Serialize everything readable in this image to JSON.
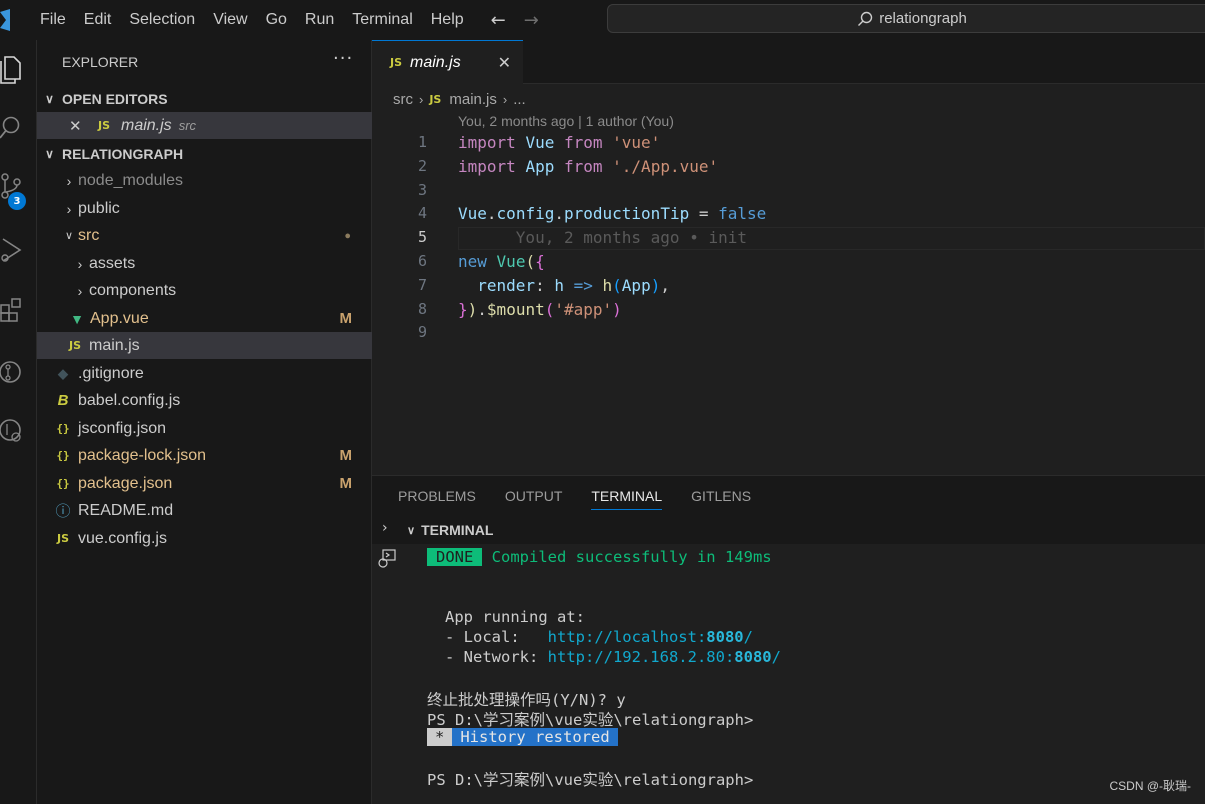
{
  "menu": [
    "File",
    "Edit",
    "Selection",
    "View",
    "Go",
    "Run",
    "Terminal",
    "Help"
  ],
  "command_center": {
    "text": "relationgraph"
  },
  "activity_bar": {
    "items": [
      "explorer-icon",
      "search-icon",
      "source-control-icon",
      "run-debug-icon",
      "extensions-icon",
      "gitlens-icon",
      "remote-explorer-icon"
    ],
    "source_control_badge": "3"
  },
  "sidebar": {
    "title": "EXPLORER",
    "more": "···",
    "open_editors": {
      "header": "OPEN EDITORS",
      "items": [
        {
          "name": "main.js",
          "folder": "src",
          "icon": "JS"
        }
      ]
    },
    "project": {
      "header": "RELATIONGRAPH",
      "rows": [
        {
          "label": "node_modules"
        },
        {
          "label": "public"
        },
        {
          "label": "src"
        },
        {
          "label": "assets"
        },
        {
          "label": "components"
        },
        {
          "label": "App.vue",
          "status": "M"
        },
        {
          "label": "main.js",
          "icon": "JS"
        },
        {
          "label": ".gitignore"
        },
        {
          "label": "babel.config.js"
        },
        {
          "label": "jsconfig.json",
          "icon": "{}"
        },
        {
          "label": "package-lock.json",
          "icon": "{}",
          "status": "M"
        },
        {
          "label": "package.json",
          "icon": "{}",
          "status": "M"
        },
        {
          "label": "README.md"
        },
        {
          "label": "vue.config.js",
          "icon": "JS"
        }
      ],
      "src_modified_dot": "●"
    }
  },
  "editor": {
    "tab": {
      "label": "main.js",
      "icon": "JS",
      "close": "✕"
    },
    "breadcrumb": [
      "src",
      "main.js",
      "..."
    ],
    "breadcrumb_icon": "JS",
    "blame_header": "You, 2 months ago | 1 author (You)",
    "line_numbers": [
      "1",
      "2",
      "3",
      "4",
      "5",
      "6",
      "7",
      "8",
      "9"
    ],
    "inline_blame": "You, 2 months ago • init"
  },
  "panel": {
    "tabs": [
      "PROBLEMS",
      "OUTPUT",
      "TERMINAL",
      "GITLENS"
    ],
    "active_tab": "TERMINAL",
    "section_header": "TERMINAL",
    "terminal": {
      "done_badge": "DONE",
      "compiled": "Compiled successfully in 149ms",
      "app_running": "App running at:",
      "local_label": "- Local:   ",
      "local_url_prefix": "http://localhost:",
      "local_port": "8080",
      "network_label": "- Network: ",
      "network_url_prefix": "http://192.168.2.80:",
      "network_port": "8080",
      "url_suffix": "/",
      "batch_prompt": "终止批处理操作吗(Y/N)? y",
      "ps_prompt_1": "PS D:\\学习案例\\vue实验\\relationgraph>",
      "history_star": "*",
      "history_restored": "History restored",
      "ps_prompt_2": "PS D:\\学习案例\\vue实验\\relationgraph>"
    }
  },
  "watermark": "CSDN @-耿瑞-",
  "colors": {
    "accent": "#0078d4",
    "modified": "#e2c08d",
    "done": "#0dbc79",
    "history": "#2472c8"
  }
}
